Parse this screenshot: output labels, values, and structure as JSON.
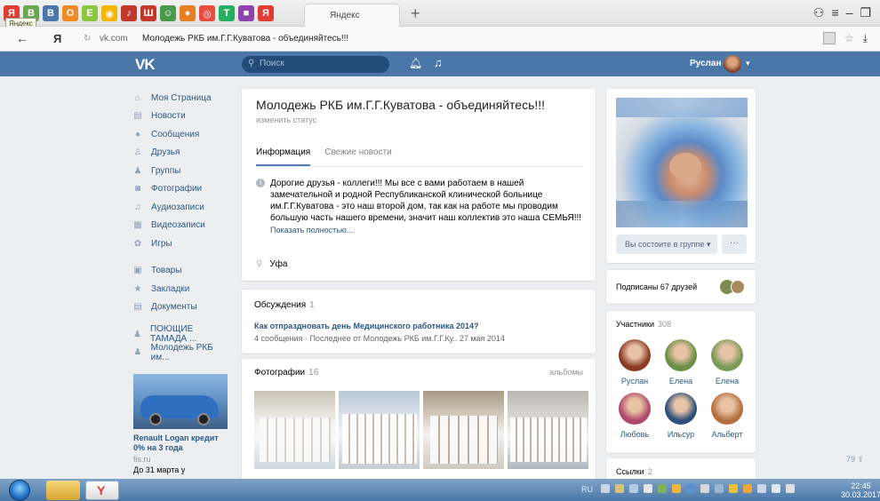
{
  "browser": {
    "tab_title": "Яндекс",
    "tab_tooltip": "Яндекс",
    "new_tab": "+",
    "yandex_logo": "Я",
    "url_domain": "vk.com",
    "url_title": "Молодежь РКБ им.Г.Г.Куватова - объединяйтесь!!!",
    "pinned_tabs": [
      {
        "label": "Я",
        "color": "#e03c31"
      },
      {
        "label": "В",
        "color": "#6aa84f"
      },
      {
        "label": "В",
        "color": "#4a76a8"
      },
      {
        "label": "О",
        "color": "#f08a24"
      },
      {
        "label": "Е",
        "color": "#8cc63f"
      },
      {
        "label": "◉",
        "color": "#f5b400"
      },
      {
        "label": "♪",
        "color": "#c0392b"
      },
      {
        "label": "Ш",
        "color": "#c0392b"
      },
      {
        "label": "☺",
        "color": "#4b9a4b"
      },
      {
        "label": "●",
        "color": "#e67e22"
      },
      {
        "label": "◎",
        "color": "#e74c3c"
      },
      {
        "label": "T",
        "color": "#27ae60"
      },
      {
        "label": "■",
        "color": "#8e44ad"
      },
      {
        "label": "Я",
        "color": "#e03c31"
      }
    ]
  },
  "vk": {
    "logo": "VK",
    "search_placeholder": "Поиск",
    "user_name": "Руслан",
    "accent": "#4a76a8"
  },
  "menu": [
    {
      "label": "Моя Страница",
      "icon": "⌂"
    },
    {
      "label": "Новости",
      "icon": "▤"
    },
    {
      "label": "Сообщения",
      "icon": "●"
    },
    {
      "label": "Друзья",
      "icon": "♙"
    },
    {
      "label": "Группы",
      "icon": "♟"
    },
    {
      "label": "Фотографии",
      "icon": "◙"
    },
    {
      "label": "Аудиозаписи",
      "icon": "♫"
    },
    {
      "label": "Видеозаписи",
      "icon": "▦"
    },
    {
      "label": "Игры",
      "icon": "✿"
    }
  ],
  "menu2": [
    {
      "label": "Товары",
      "icon": "▣"
    },
    {
      "label": "Закладки",
      "icon": "★"
    },
    {
      "label": "Документы",
      "icon": "▤"
    }
  ],
  "menu3": [
    {
      "label": "ПОЮЩИЕ ТАМАДА ...",
      "icon": "♟"
    },
    {
      "label": "Молодежь РКБ им...",
      "icon": "♟"
    }
  ],
  "ad": {
    "title": "Renault Logan кредит 0% на 3 года",
    "site": "fis.ru",
    "date": "До 31 марта у"
  },
  "group": {
    "title": "Молодежь РКБ им.Г.Г.Куватова - объединяйтесь!!!",
    "status": "изменить статус",
    "tabs": [
      "Информация",
      "Свежие новости"
    ],
    "info_text": "Дорогие друзья - коллеги!!! Мы все с вами работаем в нашей замечательной и родной Республиканской клинической больнице им.Г.Г.Куватова - это наш второй дом, так как на работе мы проводим большую часть нашего времени, значит наш коллектив это наша СЕМЬЯ!!!",
    "show_more": "Показать полностью...",
    "city": "Уфа"
  },
  "discussions": {
    "heading": "Обсуждения",
    "count": "1",
    "topic": "Как отпраздновать день Медицинского работника 2014?",
    "meta": "4 сообщения · Последнее от Молодежь РКБ им.Г.Г.Ку.. 27 мая 2014"
  },
  "photos": {
    "heading": "Фотографии",
    "count": "16",
    "albums_link": "альбомы"
  },
  "side": {
    "member_button": "Вы состоите в группе ▾",
    "more_button": "···",
    "friends_subscribed": "Подписаны 67 друзей",
    "members_heading": "Участники",
    "members_count": "308",
    "members": [
      {
        "name": "Руслан",
        "color": "#8b3a24"
      },
      {
        "name": "Елена",
        "color": "#6b8f45"
      },
      {
        "name": "Елена",
        "color": "#7a9b5a"
      },
      {
        "name": "Любовь",
        "color": "#b0486a"
      },
      {
        "name": "Ильсур",
        "color": "#2f4f7a"
      },
      {
        "name": "Альберт",
        "color": "#b66f3e"
      }
    ],
    "links_heading": "Ссылки",
    "links_count": "2"
  },
  "taskbar": {
    "lang": "RU",
    "time": "22:45",
    "date": "30.03.2017"
  },
  "scroll_badge": "79 ⇪"
}
